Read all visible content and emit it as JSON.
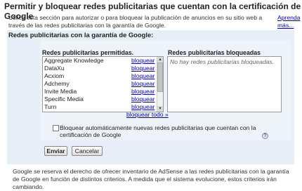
{
  "title": "Permitir y bloquear redes publicitarias que cuentan con la certificación de Google",
  "intro_text": "Utilice esta sección para autorizar o para bloquear la publicación de anuncios en su sitio web a través de las redes publicitarias con la garantía de Google.",
  "learn_more": "Aprenda más...",
  "panel_heading": "Redes publicitarias con la garantía de Google:",
  "allowed_heading": "Redes publicitarias permitidas.",
  "blocked_heading": "Redes publicitarias bloqueadas",
  "block_label": "bloquear",
  "allowed_networks": [
    "Aggregate Knowledge",
    "DataXu",
    "Acxiom",
    "Adchemy",
    "Invite Media",
    "Specific Media",
    "Turn"
  ],
  "block_all": "bloquear todo »",
  "blocked_empty": "No hay redes publicitarias bloqueadas.",
  "auto_block_label": "Bloquear automáticamente nuevas redes publicitarias que cuentan con la certificación de Google",
  "auto_block_checked": false,
  "help_icon": "help-icon",
  "buttons": {
    "send": "Enviar",
    "cancel": "Cancelar"
  },
  "footer_text": "Google se reserva el derecho de ofrecer inventario de AdSense a las redes publicitarias con la garantía de Google en función de distintos criterios. A medida que el sistema evolucione, estos criterios irán cambiando."
}
